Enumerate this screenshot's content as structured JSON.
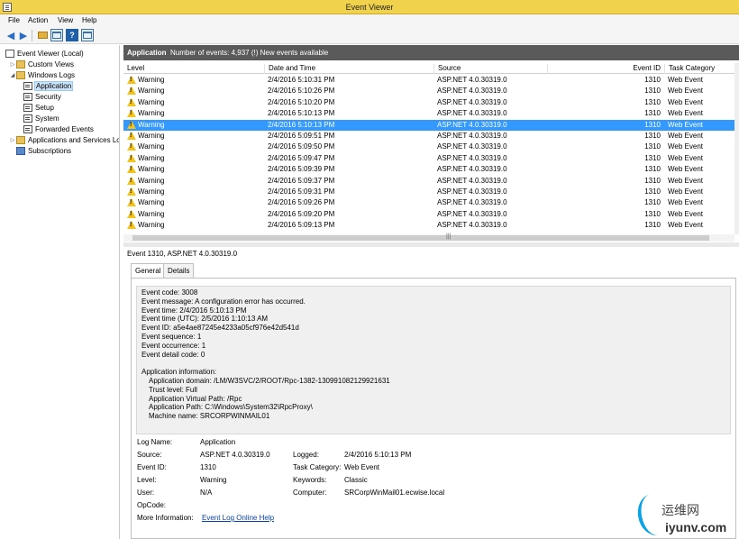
{
  "window": {
    "title": "Event Viewer"
  },
  "menu": [
    "File",
    "Action",
    "View",
    "Help"
  ],
  "tree": {
    "root": "Event Viewer (Local)",
    "custom_views": "Custom Views",
    "windows_logs": "Windows Logs",
    "application": "Application",
    "security": "Security",
    "setup": "Setup",
    "system": "System",
    "forwarded": "Forwarded Events",
    "apps_services": "Applications and Services Logs",
    "subscriptions": "Subscriptions"
  },
  "log_header": {
    "title": "Application",
    "count": "Number of events: 4,937 (!) New events available"
  },
  "columns": {
    "level": "Level",
    "date": "Date and Time",
    "source": "Source",
    "event_id": "Event ID",
    "category": "Task Category"
  },
  "events": [
    {
      "level": "Warning",
      "date": "2/4/2016 5:10:31 PM",
      "source": "ASP.NET 4.0.30319.0",
      "id": "1310",
      "category": "Web Event"
    },
    {
      "level": "Warning",
      "date": "2/4/2016 5:10:26 PM",
      "source": "ASP.NET 4.0.30319.0",
      "id": "1310",
      "category": "Web Event"
    },
    {
      "level": "Warning",
      "date": "2/4/2016 5:10:20 PM",
      "source": "ASP.NET 4.0.30319.0",
      "id": "1310",
      "category": "Web Event"
    },
    {
      "level": "Warning",
      "date": "2/4/2016 5:10:13 PM",
      "source": "ASP.NET 4.0.30319.0",
      "id": "1310",
      "category": "Web Event"
    },
    {
      "level": "Warning",
      "date": "2/4/2016 5:10:13 PM",
      "source": "ASP.NET 4.0.30319.0",
      "id": "1310",
      "category": "Web Event"
    },
    {
      "level": "Warning",
      "date": "2/4/2016 5:09:51 PM",
      "source": "ASP.NET 4.0.30319.0",
      "id": "1310",
      "category": "Web Event"
    },
    {
      "level": "Warning",
      "date": "2/4/2016 5:09:50 PM",
      "source": "ASP.NET 4.0.30319.0",
      "id": "1310",
      "category": "Web Event"
    },
    {
      "level": "Warning",
      "date": "2/4/2016 5:09:47 PM",
      "source": "ASP.NET 4.0.30319.0",
      "id": "1310",
      "category": "Web Event"
    },
    {
      "level": "Warning",
      "date": "2/4/2016 5:09:39 PM",
      "source": "ASP.NET 4.0.30319.0",
      "id": "1310",
      "category": "Web Event"
    },
    {
      "level": "Warning",
      "date": "2/4/2016 5:09:37 PM",
      "source": "ASP.NET 4.0.30319.0",
      "id": "1310",
      "category": "Web Event"
    },
    {
      "level": "Warning",
      "date": "2/4/2016 5:09:31 PM",
      "source": "ASP.NET 4.0.30319.0",
      "id": "1310",
      "category": "Web Event"
    },
    {
      "level": "Warning",
      "date": "2/4/2016 5:09:26 PM",
      "source": "ASP.NET 4.0.30319.0",
      "id": "1310",
      "category": "Web Event"
    },
    {
      "level": "Warning",
      "date": "2/4/2016 5:09:20 PM",
      "source": "ASP.NET 4.0.30319.0",
      "id": "1310",
      "category": "Web Event"
    },
    {
      "level": "Warning",
      "date": "2/4/2016 5:09:13 PM",
      "source": "ASP.NET 4.0.30319.0",
      "id": "1310",
      "category": "Web Event"
    }
  ],
  "detail": {
    "title": "Event 1310, ASP.NET 4.0.30319.0",
    "tabs": [
      "General",
      "Details"
    ],
    "description": [
      "Event code: 3008",
      "Event message: A configuration error has occurred.",
      "Event time: 2/4/2016 5:10:13 PM",
      "Event time (UTC): 2/5/2016 1:10:13 AM",
      "Event ID: a5e4ae87245e4233a05cf976e42d541d",
      "Event sequence: 1",
      "Event occurrence: 1",
      "Event detail code: 0",
      "",
      "Application information:",
      "Application domain: /LM/W3SVC/2/ROOT/Rpc-1382-130991082129921631",
      "Trust level: Full",
      "Application Virtual Path: /Rpc",
      "Application Path: C:\\Windows\\System32\\RpcProxy\\",
      "Machine name: SRCORPWINMAIL01"
    ],
    "props": {
      "log_name_label": "Log Name:",
      "log_name": "Application",
      "source_label": "Source:",
      "source": "ASP.NET 4.0.30319.0",
      "logged_label": "Logged:",
      "logged": "2/4/2016 5:10:13 PM",
      "event_id_label": "Event ID:",
      "event_id": "1310",
      "task_cat_label": "Task Category:",
      "task_cat": "Web Event",
      "level_label": "Level:",
      "level": "Warning",
      "keywords_label": "Keywords:",
      "keywords": "Classic",
      "user_label": "User:",
      "user": "N/A",
      "computer_label": "Computer:",
      "computer": "SRCorpWinMail01.ecwise.local",
      "opcode_label": "OpCode:",
      "more_info_label": "More Information:",
      "more_info_link": "Event Log Online Help"
    }
  },
  "watermark": {
    "cn": "运维网",
    "en": "iyunv.com"
  }
}
